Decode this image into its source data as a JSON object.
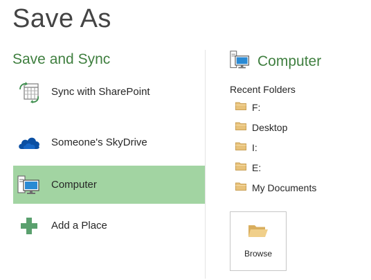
{
  "page": {
    "title": "Save As"
  },
  "left": {
    "section_heading": "Save and Sync",
    "places": [
      {
        "label": "Sync with SharePoint",
        "icon": "sharepoint-sync-icon",
        "selected": false
      },
      {
        "label": "Someone's SkyDrive",
        "icon": "skydrive-cloud-icon",
        "selected": false
      },
      {
        "label": "Computer",
        "icon": "computer-icon",
        "selected": true
      },
      {
        "label": "Add a Place",
        "icon": "plus-icon",
        "selected": false
      }
    ]
  },
  "right": {
    "heading": "Computer",
    "heading_icon": "computer-icon",
    "recent_folders_label": "Recent Folders",
    "folders": [
      {
        "name": "F:",
        "icon": "folder-icon"
      },
      {
        "name": "Desktop",
        "icon": "folder-icon"
      },
      {
        "name": "I:",
        "icon": "folder-icon"
      },
      {
        "name": "E:",
        "icon": "folder-icon"
      },
      {
        "name": "My Documents",
        "icon": "folder-icon"
      }
    ],
    "browse_label": "Browse",
    "browse_icon": "open-folder-icon"
  },
  "colors": {
    "accent_green": "#3f7f3f",
    "selected_background": "#a2d4a2",
    "skydrive_blue": "#0a4fa3",
    "folder_tan": "#e8c27a",
    "plus_green": "#5aa06e"
  }
}
